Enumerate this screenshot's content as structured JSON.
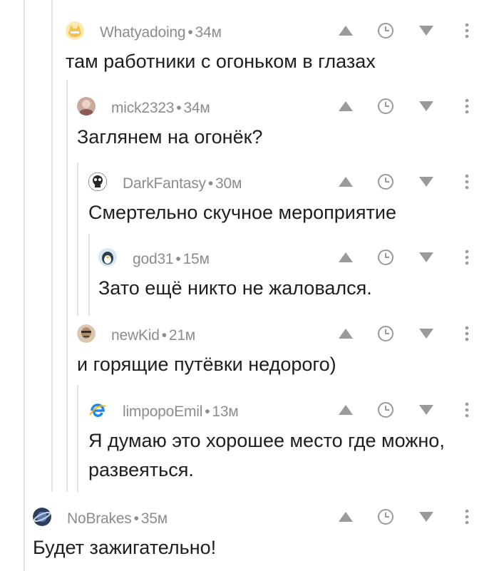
{
  "colors": {
    "meta_text": "#8c8c8c",
    "thread_line": "#e4e4e4",
    "icon": "#9a9a9a",
    "body_text": "#1e1e1e"
  },
  "icons": {
    "upvote": "triangle-up-icon",
    "save": "clock-icon",
    "downvote": "triangle-down-icon",
    "more": "vertical-dots-icon"
  },
  "separator": "•",
  "comments": [
    {
      "author": "Whatyadoing",
      "time": "34м",
      "text": "там работники с огоньком в глазах",
      "avatar": "cat-icon"
    },
    {
      "author": "mick2323",
      "time": "34м",
      "text": "Заглянем на огонёк?",
      "avatar": "photo-avatar-icon"
    },
    {
      "author": "DarkFantasy",
      "time": "30м",
      "text": "Смертельно скучное мероприятие",
      "avatar": "skull-icon"
    },
    {
      "author": "god31",
      "time": "15м",
      "text": "Зато ещё никто не жаловался.",
      "avatar": "penguin-icon"
    },
    {
      "author": "newKid",
      "time": "21м",
      "text": "и горящие путёвки недорого)",
      "avatar": "face-photo-icon"
    },
    {
      "author": "limpopoEmil",
      "time": "13м",
      "text": "Я думаю это хорошее место где можно, развеяться.",
      "avatar": "browser-e-icon"
    },
    {
      "author": "NoBrakes",
      "time": "35м",
      "text": "Будет зажигательно!",
      "avatar": "planet-icon"
    }
  ]
}
